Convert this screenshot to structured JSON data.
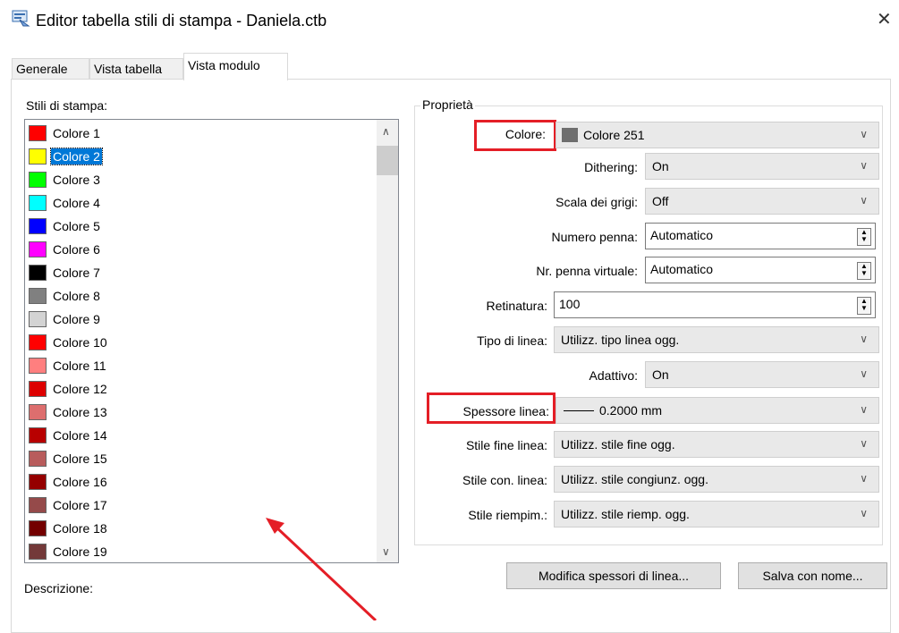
{
  "window": {
    "title": "Editor tabella stili di stampa - Daniela.ctb",
    "close_glyph": "✕"
  },
  "tabs": [
    {
      "label": "Generale",
      "active": false
    },
    {
      "label": "Vista tabella",
      "active": false
    },
    {
      "label": "Vista modulo",
      "active": true
    }
  ],
  "styles_list": {
    "label": "Stili di stampa:",
    "selected": "Colore 2",
    "items": [
      {
        "label": "Colore 1",
        "color": "#ff0000"
      },
      {
        "label": "Colore 2",
        "color": "#ffff00"
      },
      {
        "label": "Colore 3",
        "color": "#00ff00"
      },
      {
        "label": "Colore 4",
        "color": "#00ffff"
      },
      {
        "label": "Colore 5",
        "color": "#0000ff"
      },
      {
        "label": "Colore 6",
        "color": "#ff00ff"
      },
      {
        "label": "Colore 7",
        "color": "#000000"
      },
      {
        "label": "Colore 8",
        "color": "#808080"
      },
      {
        "label": "Colore 9",
        "color": "#d3d3d3"
      },
      {
        "label": "Colore 10",
        "color": "#ff0000"
      },
      {
        "label": "Colore 11",
        "color": "#ff7f7f"
      },
      {
        "label": "Colore 12",
        "color": "#dd0000"
      },
      {
        "label": "Colore 13",
        "color": "#dd6e6e"
      },
      {
        "label": "Colore 14",
        "color": "#b80000"
      },
      {
        "label": "Colore 15",
        "color": "#b85c5c"
      },
      {
        "label": "Colore 16",
        "color": "#950000"
      },
      {
        "label": "Colore 17",
        "color": "#954a4a"
      },
      {
        "label": "Colore 18",
        "color": "#730000"
      },
      {
        "label": "Colore 19",
        "color": "#733939"
      }
    ]
  },
  "description_label": "Descrizione:",
  "properties": {
    "title": "Proprietà",
    "color": {
      "label": "Colore:",
      "value": "Colore 251",
      "swatch": "#6e6e6e"
    },
    "dithering": {
      "label": "Dithering:",
      "value": "On"
    },
    "grayscale": {
      "label": "Scala dei grigi:",
      "value": "Off"
    },
    "pen_number": {
      "label": "Numero penna:",
      "value": "Automatico"
    },
    "virtual_pen": {
      "label": "Nr. penna virtuale:",
      "value": "Automatico"
    },
    "screening": {
      "label": "Retinatura:",
      "value": "100"
    },
    "linetype": {
      "label": "Tipo di linea:",
      "value": "Utilizz. tipo linea ogg."
    },
    "adaptive": {
      "label": "Adattivo:",
      "value": "On"
    },
    "lineweight": {
      "label": "Spessore linea:",
      "value": "0.2000 mm"
    },
    "line_end": {
      "label": "Stile fine linea:",
      "value": "Utilizz. stile fine ogg."
    },
    "line_join": {
      "label": "Stile con. linea:",
      "value": "Utilizz. stile congiunz. ogg."
    },
    "fill_style": {
      "label": "Stile riempim.:",
      "value": "Utilizz. stile riemp. ogg."
    }
  },
  "buttons": {
    "edit_lineweights": "Modifica spessori di linea...",
    "save_as": "Salva con nome..."
  },
  "annotation_color": "#e41e26"
}
